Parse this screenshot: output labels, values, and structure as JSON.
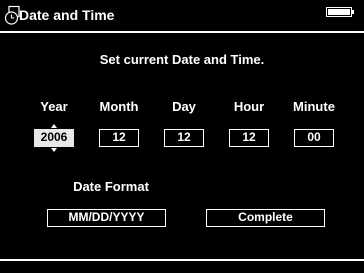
{
  "header": {
    "title": "Date and Time",
    "title_icon": "clock-icon",
    "battery_icon": "battery-icon"
  },
  "main": {
    "prompt": "Set current Date and Time.",
    "columns": [
      {
        "label": "Year",
        "value": "2006"
      },
      {
        "label": "Month",
        "value": "12"
      },
      {
        "label": "Day",
        "value": "12"
      },
      {
        "label": "Hour",
        "value": "12"
      },
      {
        "label": "Minute",
        "value": "00"
      }
    ],
    "date_format_label": "Date Format",
    "date_format_value": "MM/DD/YYYY",
    "complete_label": "Complete"
  },
  "colors": {
    "background": "#000000",
    "foreground": "#ffffff",
    "selected_bg": "#e8e8e8"
  }
}
